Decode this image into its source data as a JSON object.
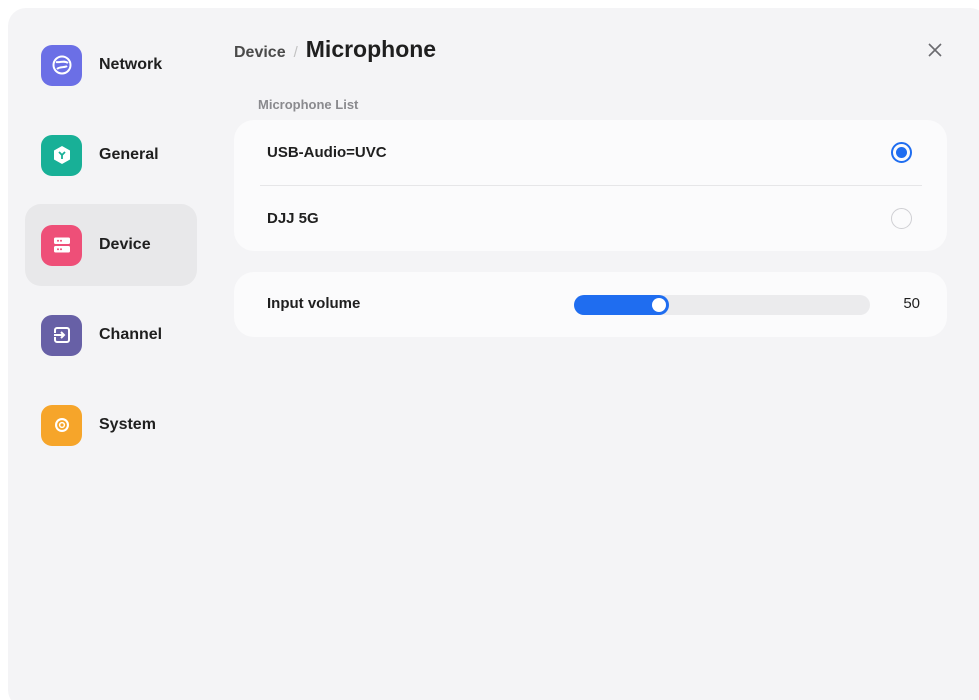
{
  "sidebar": {
    "items": [
      {
        "label": "Network",
        "icon": "globe-icon",
        "color": "#6b6fe6",
        "active": false
      },
      {
        "label": "General",
        "icon": "cube-icon",
        "color": "#18b097",
        "active": false
      },
      {
        "label": "Device",
        "icon": "server-icon",
        "color": "#ee4f78",
        "active": true
      },
      {
        "label": "Channel",
        "icon": "input-arrow-icon",
        "color": "#6760a6",
        "active": false
      },
      {
        "label": "System",
        "icon": "gear-icon",
        "color": "#f6a52a",
        "active": false
      }
    ]
  },
  "header": {
    "parent": "Device",
    "separator": "/",
    "title": "Microphone",
    "close_icon": "close-icon"
  },
  "microphones": {
    "section_label": "Microphone List",
    "items": [
      {
        "name": "USB-Audio=UVC",
        "selected": true
      },
      {
        "name": "DJJ 5G",
        "selected": false
      }
    ]
  },
  "volume": {
    "label": "Input volume",
    "value": "50",
    "level_percent": 32
  },
  "colors": {
    "accent": "#1f6df0",
    "background": "#f4f4f6",
    "card": "#fbfbfc"
  }
}
